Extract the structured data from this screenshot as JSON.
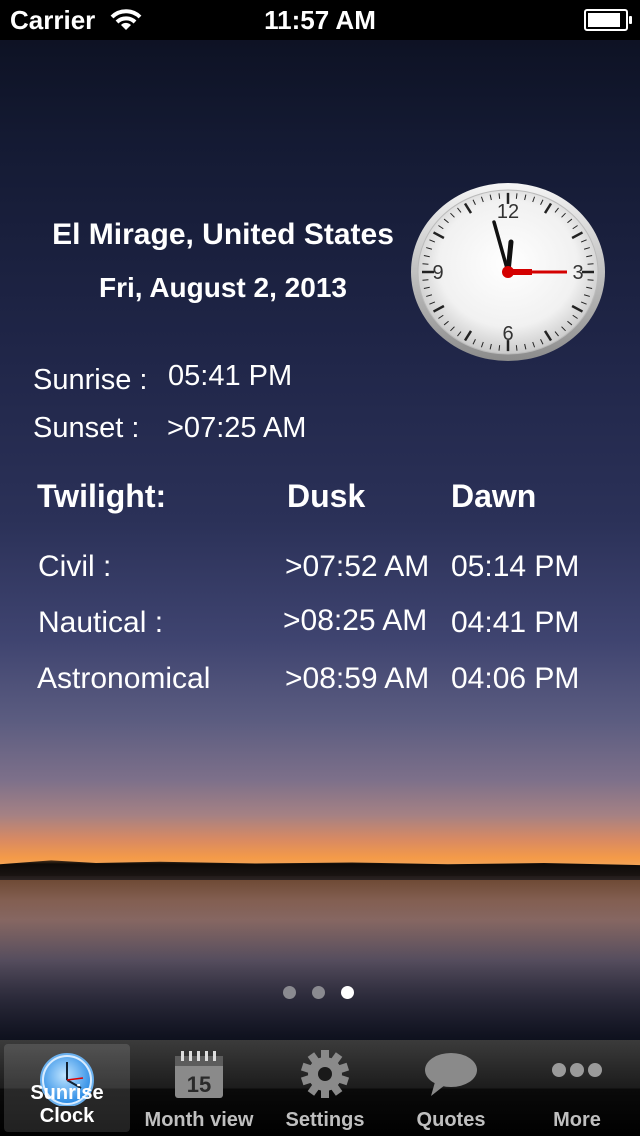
{
  "status_bar": {
    "carrier": "Carrier",
    "time": "11:57 AM"
  },
  "header": {
    "location": "El Mirage, United States",
    "date": "Fri, August 2, 2013"
  },
  "sun": {
    "sunrise_label": "Sunrise :",
    "sunrise_value": "05:41 PM",
    "sunset_label": "Sunset :",
    "sunset_value": ">07:25 AM"
  },
  "twilight": {
    "title": "Twilight:",
    "dusk_header": "Dusk",
    "dawn_header": "Dawn",
    "rows": [
      {
        "label": "Civil :",
        "dusk": ">07:52 AM",
        "dawn": "05:14 PM"
      },
      {
        "label": "Nautical :",
        "dusk": ">08:25 AM",
        "dawn": "04:41 PM"
      },
      {
        "label": "Astronomical",
        "dusk": ">08:59 AM",
        "dawn": "04:06 PM"
      }
    ]
  },
  "clock": {
    "numerals": [
      "12",
      "3",
      "6",
      "9"
    ]
  },
  "page_indicator": {
    "count": 3,
    "active_index": 2
  },
  "tabs": [
    {
      "label": "Sunrise Clock",
      "icon": "clock-icon",
      "active": true
    },
    {
      "label": "Month view",
      "icon": "calendar-icon",
      "icon_text": "15",
      "active": false
    },
    {
      "label": "Settings",
      "icon": "gear-icon",
      "active": false
    },
    {
      "label": "Quotes",
      "icon": "speech-bubble-icon",
      "active": false
    },
    {
      "label": "More",
      "icon": "more-dots-icon",
      "active": false
    }
  ]
}
